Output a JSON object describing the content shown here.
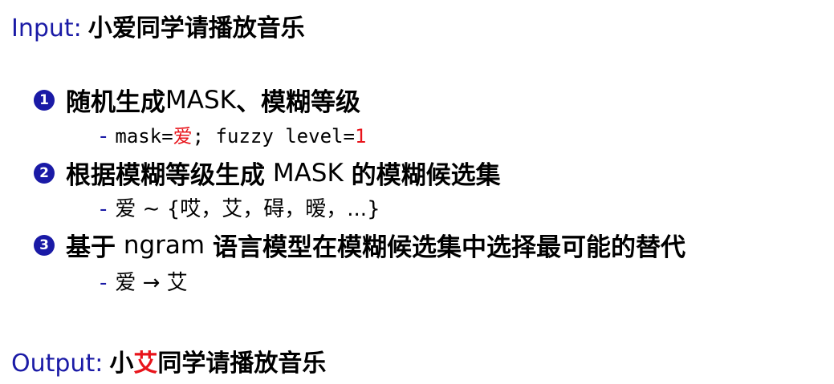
{
  "input": {
    "label": "Input:",
    "text": "小爱同学请播放音乐"
  },
  "steps": [
    {
      "num": "1",
      "text_a": "随机生成",
      "text_b": " MASK",
      "text_c": "、模糊等级",
      "sub": {
        "prefix": "mask=",
        "masked_char": "爱",
        "middle": "; fuzzy level=",
        "level": "1"
      }
    },
    {
      "num": "2",
      "text_a": "根据模糊等级生成",
      "text_b": " MASK ",
      "text_c": "的模糊候选集",
      "sub": {
        "char": "爱",
        "rel": " ∼ ",
        "set": "{哎，艾，碍，暧，...}"
      }
    },
    {
      "num": "3",
      "text_a": "基于",
      "text_b": " ngram ",
      "text_c": "语言模型在模糊候选集中选择最可能的替代",
      "sub": {
        "from": "爱",
        "arrow": " → ",
        "to": "艾"
      }
    }
  ],
  "output": {
    "label": "Output:",
    "pre": "小",
    "replaced": "艾",
    "post": "同学请播放音乐"
  },
  "colors": {
    "accent": "#1a1aa6",
    "highlight": "#e8141b"
  }
}
